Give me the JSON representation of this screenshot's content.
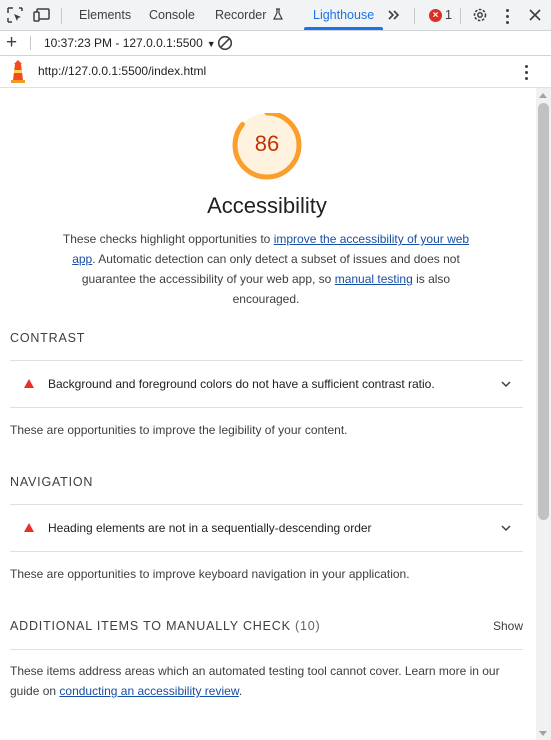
{
  "tabs": {
    "items": [
      "Elements",
      "Console",
      "Recorder",
      "Lighthouse"
    ],
    "active": "Lighthouse",
    "error_count": "1"
  },
  "report_bar": {
    "selected_report": "10:37:23 PM - 127.0.0.1:5500"
  },
  "url_bar": {
    "url": "http://127.0.0.1:5500/index.html"
  },
  "category": {
    "score": "86",
    "score_color": "#fa9f2b",
    "title": "Accessibility",
    "desc_part1": "These checks highlight opportunities to ",
    "desc_link1": "improve the accessibility of your web app",
    "desc_part2": ". Automatic detection can only detect a subset of issues and does not guarantee the accessibility of your web app, so ",
    "desc_link2": "manual testing",
    "desc_part3": " is also encouraged."
  },
  "groups": [
    {
      "title": "CONTRAST",
      "audit": "Background and foreground colors do not have a sufficient contrast ratio.",
      "description": "These are opportunities to improve the legibility of your content."
    },
    {
      "title": "NAVIGATION",
      "audit": "Heading elements are not in a sequentially-descending order",
      "description": "These are opportunities to improve keyboard navigation in your application."
    }
  ],
  "manual": {
    "title": "ADDITIONAL ITEMS TO MANUALLY CHECK",
    "count": "(10)",
    "show_label": "Show",
    "desc_part1": "These items address areas which an automated testing tool cannot cover. Learn more in our guide on ",
    "desc_link": "conducting an accessibility review",
    "desc_part2": "."
  },
  "colors": {
    "accent": "#1a73e8",
    "fail_red": "#e8302a",
    "score_text": "#c33300"
  }
}
